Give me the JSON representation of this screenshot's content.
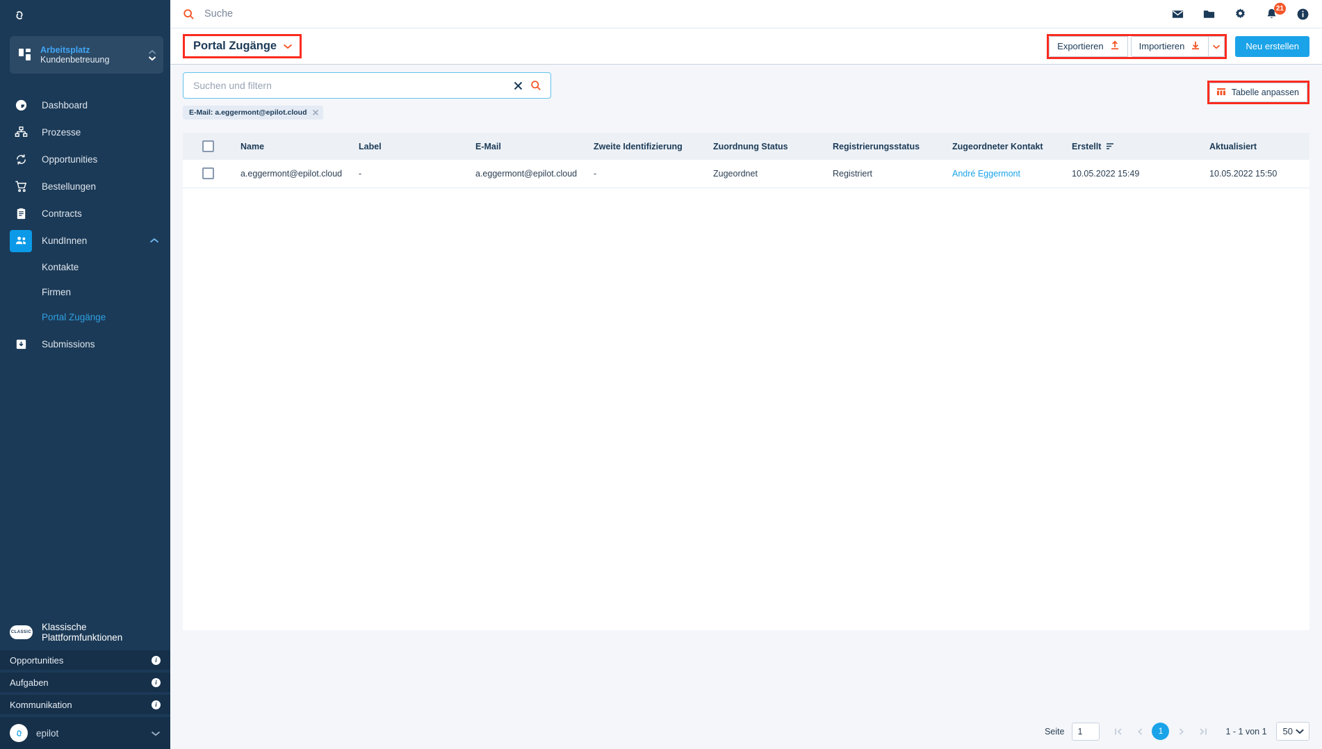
{
  "sidebar": {
    "logo_icon": "epilot-logo-icon",
    "workspace": {
      "title": "Arbeitsplatz",
      "subtitle": "Kundenbetreuung",
      "icon": "grid-icon"
    },
    "nav": [
      {
        "label": "Dashboard",
        "icon": "dashboard-icon"
      },
      {
        "label": "Prozesse",
        "icon": "workflow-icon"
      },
      {
        "label": "Opportunities",
        "icon": "refresh-icon"
      },
      {
        "label": "Bestellungen",
        "icon": "cart-icon"
      },
      {
        "label": "Contracts",
        "icon": "clipboard-icon"
      },
      {
        "label": "KundInnen",
        "icon": "people-icon"
      }
    ],
    "subnav": [
      {
        "label": "Kontakte"
      },
      {
        "label": "Firmen"
      },
      {
        "label": "Portal Zugänge"
      }
    ],
    "nav_after": [
      {
        "label": "Submissions",
        "icon": "inbox-icon"
      }
    ],
    "classic": {
      "pill": "CLASSIC",
      "heading": "Klassische Plattformfunktionen",
      "rows": [
        {
          "label": "Opportunities",
          "info": "i"
        },
        {
          "label": "Aufgaben",
          "info": "i"
        },
        {
          "label": "Kommunikation",
          "info": "i"
        }
      ]
    },
    "footer": {
      "name": "epilot",
      "icon": "epilot-avatar-icon"
    }
  },
  "topbar": {
    "search_icon": "search-icon",
    "search_placeholder": "Suche",
    "icons": [
      {
        "name": "mail-icon"
      },
      {
        "name": "folder-icon"
      },
      {
        "name": "gear-icon"
      },
      {
        "name": "bell-icon",
        "badge": "21"
      },
      {
        "name": "info-icon"
      }
    ]
  },
  "pagebar": {
    "title": "Portal Zugänge",
    "title_caret": "chevron-down-icon",
    "export_label": "Exportieren",
    "export_icon": "upload-icon",
    "import_label": "Importieren",
    "import_icon": "download-icon",
    "import_caret": "chevron-down-icon",
    "new_label": "Neu erstellen",
    "accent": "#1aa3e8",
    "highlight": "#fb2b1f"
  },
  "filters": {
    "search_value": "",
    "search_placeholder": "Suchen und filtern",
    "clear_icon": "close-icon",
    "submit_icon": "search-icon",
    "chips": [
      {
        "label": "E-Mail: a.eggermont@epilot.cloud",
        "remove_icon": "close-icon"
      }
    ],
    "customize_label": "Tabelle anpassen",
    "customize_icon": "table-columns-icon"
  },
  "table": {
    "columns": [
      "",
      "Name",
      "Label",
      "E-Mail",
      "Zweite Identifizierung",
      "Zuordnung Status",
      "Registrierungsstatus",
      "Zugeordneter Kontakt",
      "Erstellt",
      "Aktualisiert"
    ],
    "sorted_column": "Erstellt",
    "sort_icon": "sort-icon",
    "rows": [
      {
        "name": "a.eggermont@epilot.cloud",
        "label": "-",
        "email": "a.eggermont@epilot.cloud",
        "zweite_identifizierung": "-",
        "zuordnung_status": "Zugeordnet",
        "registrierungsstatus": "Registriert",
        "zugeordneter_kontakt": "André Eggermont",
        "erstellt": "10.05.2022 15:49",
        "aktualisiert": "10.05.2022 15:50"
      }
    ]
  },
  "pagination": {
    "page_label": "Seite",
    "page_value": "1",
    "current_page": "1",
    "range_text": "1 - 1 von 1",
    "page_size": "50",
    "first_icon": "first-page-icon",
    "prev_icon": "prev-page-icon",
    "next_icon": "next-page-icon",
    "last_icon": "last-page-icon",
    "size_caret": "chevron-down-icon"
  }
}
